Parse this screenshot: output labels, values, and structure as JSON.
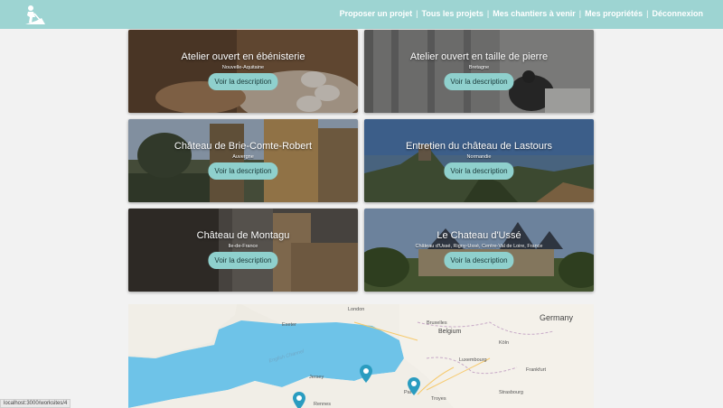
{
  "header": {
    "logo_icon": "worker-shovel-icon",
    "nav": [
      {
        "label": "Proposer un projet"
      },
      {
        "label": "Tous les projets"
      },
      {
        "label": "Mes chantiers à venir"
      },
      {
        "label": "Mes propriétés"
      },
      {
        "label": "Déconnexion"
      }
    ],
    "separator": "|"
  },
  "cards": [
    {
      "title": "Atelier ouvert en ébénisterie",
      "region": "Nouvelle-Aquitaine",
      "button": "Voir la description"
    },
    {
      "title": "Atelier ouvert en taille de pierre",
      "region": "Bretagne",
      "button": "Voir la description"
    },
    {
      "title": "Château de Brie-Comte-Robert",
      "region": "Auvergne",
      "button": "Voir la description"
    },
    {
      "title": "Entretien du château de Lastours",
      "region": "Normandie",
      "button": "Voir la description"
    },
    {
      "title": "Château de Montagu",
      "region": "Ile-de-France",
      "button": "Voir la description"
    },
    {
      "title": "Le Chateau d'Ussé",
      "region": "Château d'Ussé, Rigny-Ussé, Centre-Val de Loire, France",
      "button": "Voir la description"
    }
  ],
  "map": {
    "labels": {
      "germany": "Germany",
      "london": "London",
      "belgium": "Belgium",
      "luxembourg": "Luxembourg",
      "channel": "English Channel",
      "jersey": "Jersey",
      "paris": "Paris",
      "exeter": "Exeter",
      "cologne": "Köln",
      "frankfurt": "Frankfurt",
      "strasbourg": "Strasbourg",
      "troyes": "Troyes",
      "rennes": "Rennes",
      "bruxelles": "Bruxelles"
    },
    "marker_icon": "map-pin-icon"
  },
  "status_url": "localhost:3000/worksites/4"
}
